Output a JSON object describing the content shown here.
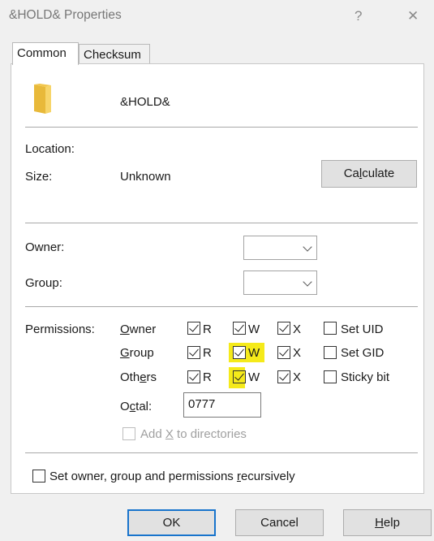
{
  "window": {
    "title": "&HOLD& Properties",
    "help_glyph": "?",
    "close_glyph": "✕"
  },
  "tabs": [
    {
      "label": "Common",
      "active": true
    },
    {
      "label": "Checksum",
      "active": false
    }
  ],
  "file": {
    "name": "&HOLD&",
    "icon": "folder-icon"
  },
  "info": {
    "location_label": "Location:",
    "size_label": "Size:",
    "size_value": "Unknown",
    "calculate_pre": "Ca",
    "calculate_u": "l",
    "calculate_post": "culate"
  },
  "ownership": {
    "owner_label": "Owner:",
    "group_label": "Group:"
  },
  "permissions": {
    "label": "Permissions:",
    "rows": [
      {
        "pre": "",
        "u": "O",
        "post": "wner",
        "r": "R",
        "w": "W",
        "x": "X",
        "extra": "Set UID"
      },
      {
        "pre": "",
        "u": "G",
        "post": "roup",
        "r": "R",
        "w": "W",
        "x": "X",
        "extra": "Set GID"
      },
      {
        "pre": "Oth",
        "u": "e",
        "post": "rs",
        "r": "R",
        "w": "W",
        "x": "X",
        "extra": "Sticky bit"
      }
    ],
    "octal_pre": "O",
    "octal_u": "c",
    "octal_post": "tal:",
    "octal_value": "0777",
    "add_x_pre": "Add ",
    "add_x_u": "X",
    "add_x_post": " to directories"
  },
  "recursive": {
    "pre": "Set owner, group and permissions ",
    "u": "r",
    "post": "ecursively"
  },
  "buttons": {
    "ok": "OK",
    "cancel": "Cancel",
    "help_u": "H",
    "help_post": "elp"
  },
  "colors": {
    "highlight": "#f5ea1a",
    "default_button_border": "#1874cc"
  }
}
